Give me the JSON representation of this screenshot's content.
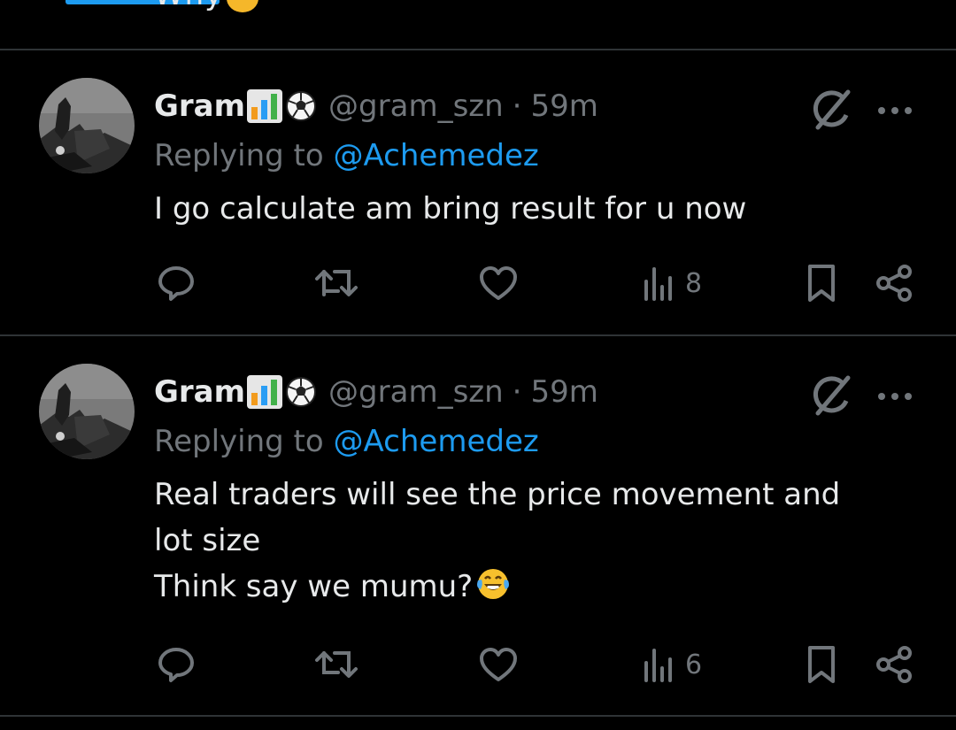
{
  "top_snippet": {
    "text": "Why"
  },
  "tweets": [
    {
      "name": "Gram",
      "handle": "@gram_szn",
      "separator": "·",
      "time": "59m",
      "replying_prefix": "Replying to ",
      "replying_to": "@Achemedez",
      "text_lines": [
        "I go calculate am bring result for u now"
      ],
      "text_emoji": "",
      "views": "8"
    },
    {
      "name": "Gram",
      "handle": "@gram_szn",
      "separator": "·",
      "time": "59m",
      "replying_prefix": "Replying to ",
      "replying_to": "@Achemedez",
      "text_lines": [
        "Real traders will see the price movement and",
        "lot size",
        "Think say we mumu?"
      ],
      "text_emoji": "face-with-tears-of-joy",
      "views": "6"
    }
  ],
  "colors": {
    "background": "#000000",
    "text": "#e7e9ea",
    "secondary": "#71767b",
    "accent": "#1d9bf0",
    "divider": "#2f3336"
  },
  "icons": [
    "reply-icon",
    "repost-icon",
    "like-icon",
    "views-icon",
    "bookmark-icon",
    "share-icon",
    "grok-icon",
    "more-icon"
  ]
}
